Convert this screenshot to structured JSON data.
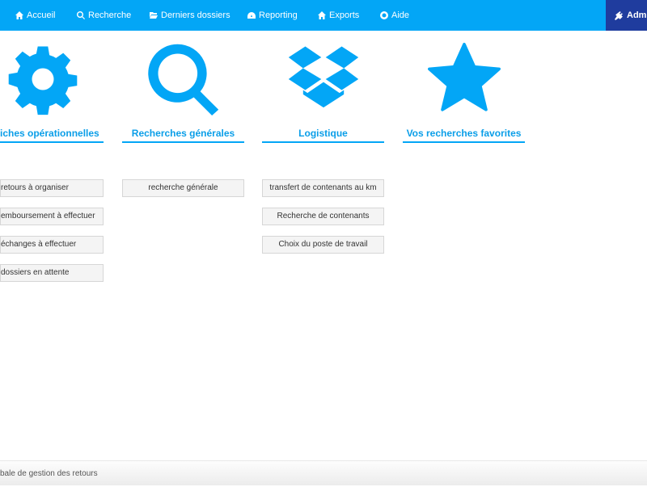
{
  "nav": {
    "items": [
      {
        "label": "Accueil",
        "icon": "home-icon"
      },
      {
        "label": "Recherche",
        "icon": "search-icon"
      },
      {
        "label": "Derniers dossiers",
        "icon": "folder-open-icon"
      },
      {
        "label": "Reporting",
        "icon": "dashboard-icon"
      },
      {
        "label": "Exports",
        "icon": "home-icon"
      },
      {
        "label": "Aide",
        "icon": "lifebuoy-icon"
      }
    ],
    "admin_label": "Admi"
  },
  "columns": [
    {
      "title": "iches opérationnelles",
      "icon": "gear-icon",
      "buttons": [
        "retours à organiser",
        "emboursement à effectuer",
        "échanges à effectuer",
        "dossiers en attente"
      ]
    },
    {
      "title": "Recherches générales",
      "icon": "search-icon",
      "buttons": [
        "recherche générale"
      ]
    },
    {
      "title": "Logistique",
      "icon": "dropbox-icon",
      "buttons": [
        "transfert de contenants au km",
        "Recherche de contenants",
        "Choix du poste de travail"
      ]
    },
    {
      "title": "Vos recherches favorites",
      "icon": "star-icon",
      "buttons": []
    }
  ],
  "footer": {
    "text": "bale de gestion des retours"
  },
  "colors": {
    "primary": "#03a6f6",
    "admin": "#1f3c9e"
  }
}
